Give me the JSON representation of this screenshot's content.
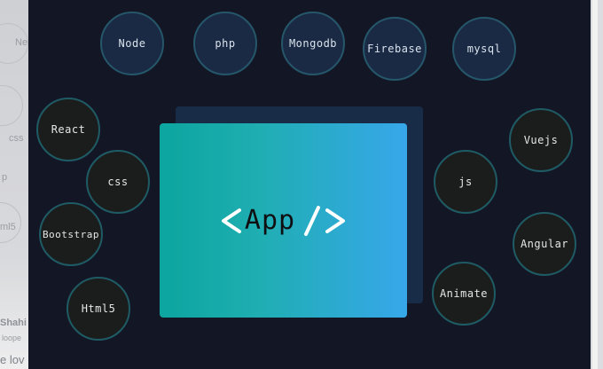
{
  "background": {
    "left_fragments": [
      "Ne",
      "css",
      "p",
      "ml5",
      "Shahi",
      "loope",
      "e lov"
    ]
  },
  "bubbles": {
    "node": "Node",
    "php": "php",
    "mongodb": "Mongodb",
    "firebase": "Firebase",
    "mysql": "mysql",
    "react": "React",
    "css": "css",
    "bootstrap": "Bootstrap",
    "html5": "Html5",
    "vuejs": "Vuejs",
    "js": "js",
    "angular": "Angular",
    "animate": "Animate"
  },
  "app_panel": {
    "label": "App"
  },
  "colors": {
    "stage_bg": "#131625",
    "bubble_blue": "#1a2a44",
    "bubble_dark": "#1b1d1d",
    "bubble_border": "#1f5b64",
    "panel_gradient_start": "#0ca59f",
    "panel_gradient_end": "#37a7ea",
    "back_panel": "#192c47"
  },
  "icons": [
    "code-open-bracket-icon",
    "code-close-slash-icon"
  ]
}
